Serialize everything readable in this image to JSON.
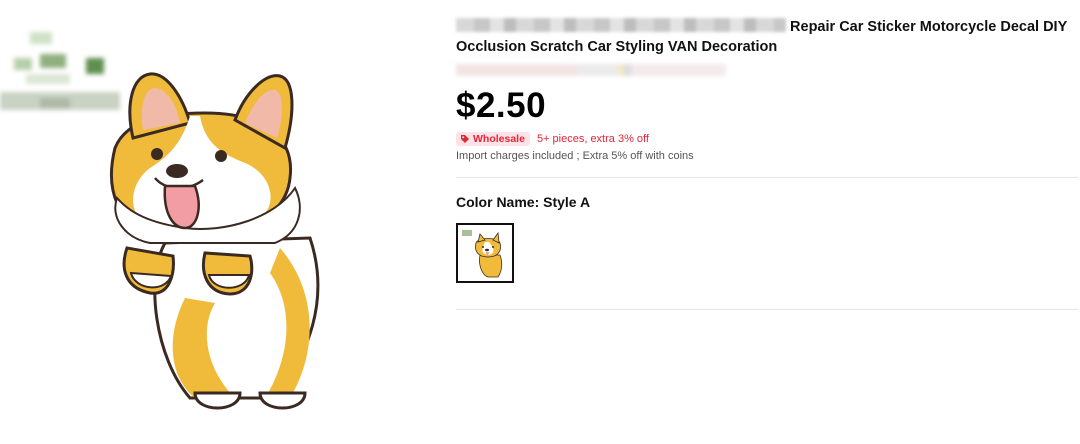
{
  "product": {
    "title_visible": "Repair Car Sticker Motorcycle Decal DIY Occlusion Scratch Car Styling VAN Decoration",
    "price": "$2.50",
    "wholesale_badge": "Wholesale",
    "wholesale_offer": "5+ pieces, extra 3% off",
    "import_note": "Import charges included ; Extra 5% off with coins",
    "color_label": "Color Name: Style A"
  },
  "swatches": [
    {
      "name": "Style A",
      "selected": true
    }
  ],
  "icons": {
    "badge": "tag-icon"
  },
  "colors": {
    "accent": "#e0273a",
    "badge_bg": "#ffe2e5",
    "corgi_orange": "#f0bb3b"
  }
}
